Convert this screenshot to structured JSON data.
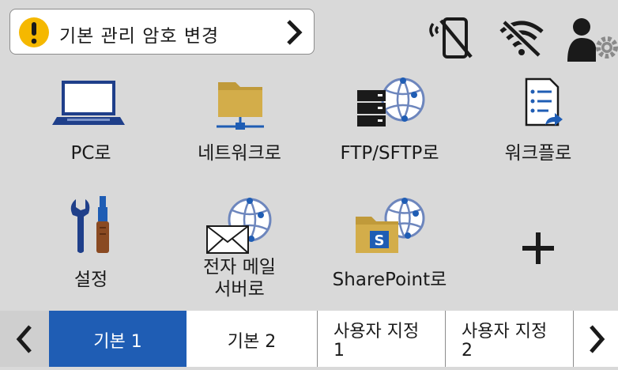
{
  "alert": {
    "text": "기본 관리 암호 변경",
    "icon": "warning-icon",
    "color": "#f5b800"
  },
  "status_icons": [
    "mobile-disabled-icon",
    "wifi-off-icon",
    "user-settings-icon"
  ],
  "tiles": [
    {
      "label": "PC로",
      "icon": "laptop-icon"
    },
    {
      "label": "네트워크로",
      "icon": "network-folder-icon"
    },
    {
      "label": "FTP/SFTP로",
      "icon": "ftp-server-icon"
    },
    {
      "label": "워크플로",
      "icon": "workflow-icon"
    },
    {
      "label": "설정",
      "icon": "tools-icon"
    },
    {
      "label": "전자 메일\n서버로",
      "icon": "email-server-icon"
    },
    {
      "label": "SharePoint로",
      "icon": "sharepoint-icon"
    },
    {
      "label": "",
      "icon": "plus-icon"
    }
  ],
  "tabs": [
    {
      "line1": "기본 1",
      "line2": "",
      "active": true
    },
    {
      "line1": "기본 2",
      "line2": "",
      "active": false
    },
    {
      "line1": "사용자 지정",
      "line2": "1",
      "active": false
    },
    {
      "line1": "사용자 지정",
      "line2": "2",
      "active": false
    }
  ],
  "colors": {
    "background": "#d9d9d9",
    "active_tab": "#1f5db4",
    "warning": "#f5b800",
    "folder": "#c09a3a",
    "sharepoint_blue": "#1f5db4"
  }
}
